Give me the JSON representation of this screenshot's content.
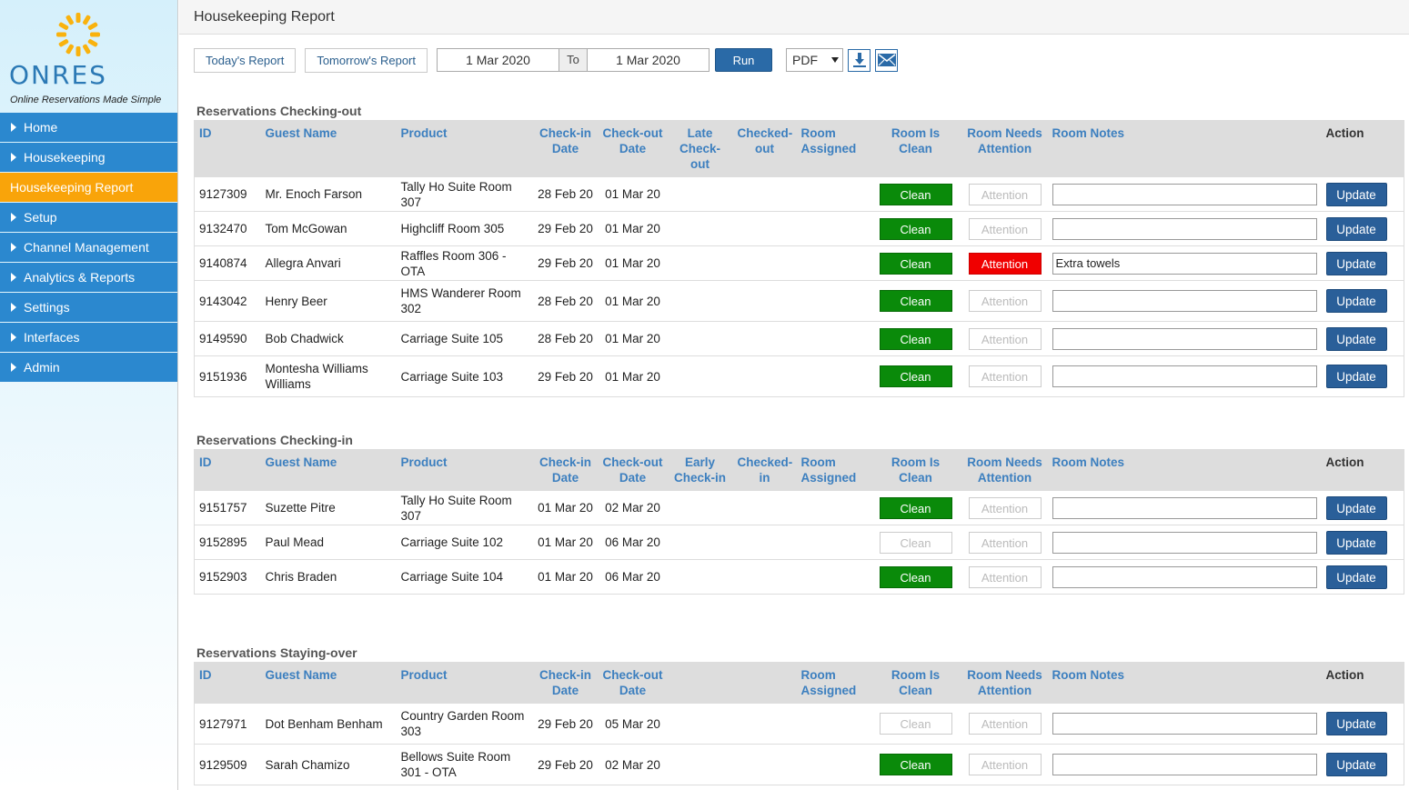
{
  "brand": {
    "name": "ONRES",
    "tagline": "Online Reservations Made Simple"
  },
  "nav": [
    {
      "label": "Home",
      "arrow": true
    },
    {
      "label": "Housekeeping",
      "arrow": true
    },
    {
      "label": "Housekeeping Report",
      "arrow": false,
      "active": true
    },
    {
      "label": "Setup",
      "arrow": true
    },
    {
      "label": "Channel Management",
      "arrow": true
    },
    {
      "label": "Analytics & Reports",
      "arrow": true
    },
    {
      "label": "Settings",
      "arrow": true
    },
    {
      "label": "Interfaces",
      "arrow": true
    },
    {
      "label": "Admin",
      "arrow": true
    }
  ],
  "page_title": "Housekeeping Report",
  "toolbar": {
    "today_label": "Today's Report",
    "tomorrow_label": "Tomorrow's Report",
    "date_from": "1 Mar 2020",
    "to_label": "To",
    "date_to": "1 Mar 2020",
    "run_label": "Run",
    "format": "PDF"
  },
  "colors": {
    "accent": "#2b88cf",
    "active": "#f9a40a",
    "clean": "#0a8a0a",
    "attention": "#f00000"
  },
  "sections": [
    {
      "title": "Reservations Checking-out",
      "headers": [
        "ID",
        "Guest Name",
        "Product",
        "Check-in Date",
        "Check-out Date",
        "Late Check-out",
        "Checked-out",
        "Room Assigned",
        "Room Is Clean",
        "Room Needs Attention",
        "Room Notes",
        "Action"
      ],
      "rows": [
        {
          "id": "9127309",
          "guest": "Mr. Enoch Farson",
          "product": "Tally Ho Suite Room 307",
          "checkin": "28 Feb 20",
          "checkout": "01 Mar 20",
          "clean": true,
          "attention": false,
          "notes": "",
          "tall": false
        },
        {
          "id": "9132470",
          "guest": "Tom McGowan",
          "product": "Highcliff Room 305",
          "checkin": "29 Feb 20",
          "checkout": "01 Mar 20",
          "clean": true,
          "attention": false,
          "notes": "",
          "tall": false
        },
        {
          "id": "9140874",
          "guest": "Allegra Anvari",
          "product": "Raffles Room 306 - OTA",
          "checkin": "29 Feb 20",
          "checkout": "01 Mar 20",
          "clean": true,
          "attention": true,
          "notes": "Extra towels",
          "tall": false
        },
        {
          "id": "9143042",
          "guest": "Henry Beer",
          "product": "HMS Wanderer Room 302",
          "checkin": "28 Feb 20",
          "checkout": "01 Mar 20",
          "clean": true,
          "attention": false,
          "notes": "",
          "tall": true
        },
        {
          "id": "9149590",
          "guest": "Bob Chadwick",
          "product": "Carriage Suite 105",
          "checkin": "28 Feb 20",
          "checkout": "01 Mar 20",
          "clean": true,
          "attention": false,
          "notes": "",
          "tall": false
        },
        {
          "id": "9151936",
          "guest": "Montesha Williams Williams",
          "product": "Carriage Suite 103",
          "checkin": "29 Feb 20",
          "checkout": "01 Mar 20",
          "clean": true,
          "attention": false,
          "notes": "",
          "tall": true
        }
      ]
    },
    {
      "title": "Reservations Checking-in",
      "headers": [
        "ID",
        "Guest Name",
        "Product",
        "Check-in Date",
        "Check-out Date",
        "Early Check-in",
        "Checked-in",
        "Room Assigned",
        "Room Is Clean",
        "Room Needs Attention",
        "Room Notes",
        "Action"
      ],
      "rows": [
        {
          "id": "9151757",
          "guest": "Suzette Pitre",
          "product": "Tally Ho Suite Room 307",
          "checkin": "01 Mar 20",
          "checkout": "02 Mar 20",
          "clean": true,
          "attention": false,
          "notes": "",
          "tall": false
        },
        {
          "id": "9152895",
          "guest": "Paul Mead",
          "product": "Carriage Suite 102",
          "checkin": "01 Mar 20",
          "checkout": "06 Mar 20",
          "clean": false,
          "attention": false,
          "notes": "",
          "tall": false
        },
        {
          "id": "9152903",
          "guest": "Chris Braden",
          "product": "Carriage Suite 104",
          "checkin": "01 Mar 20",
          "checkout": "06 Mar 20",
          "clean": true,
          "attention": false,
          "notes": "",
          "tall": false
        }
      ]
    },
    {
      "title": "Reservations Staying-over",
      "headers": [
        "ID",
        "Guest Name",
        "Product",
        "Check-in Date",
        "Check-out Date",
        "",
        "",
        "Room Assigned",
        "Room Is Clean",
        "Room Needs Attention",
        "Room Notes",
        "Action"
      ],
      "rows": [
        {
          "id": "9127971",
          "guest": "Dot Benham Benham",
          "product": "Country Garden Room 303",
          "checkin": "29 Feb 20",
          "checkout": "05 Mar 20",
          "clean": false,
          "attention": false,
          "notes": "",
          "tall": true
        },
        {
          "id": "9129509",
          "guest": "Sarah Chamizo",
          "product": "Bellows Suite Room 301 - OTA",
          "checkin": "29 Feb 20",
          "checkout": "02 Mar 20",
          "clean": true,
          "attention": false,
          "notes": "",
          "tall": true
        }
      ]
    }
  ],
  "labels": {
    "clean": "Clean",
    "attention": "Attention",
    "update": "Update"
  }
}
